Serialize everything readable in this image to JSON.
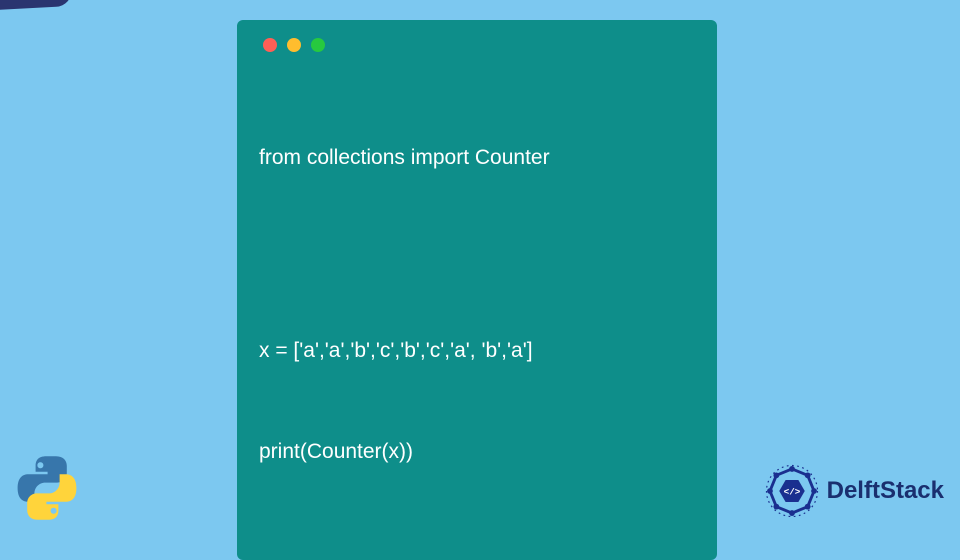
{
  "code": {
    "line1": "from collections import Counter",
    "line2": "x = ['a','a','b','c','b','c','a', 'b','a']",
    "line3": "print(Counter(x))"
  },
  "branding": {
    "delftstack": "DelftStack"
  }
}
